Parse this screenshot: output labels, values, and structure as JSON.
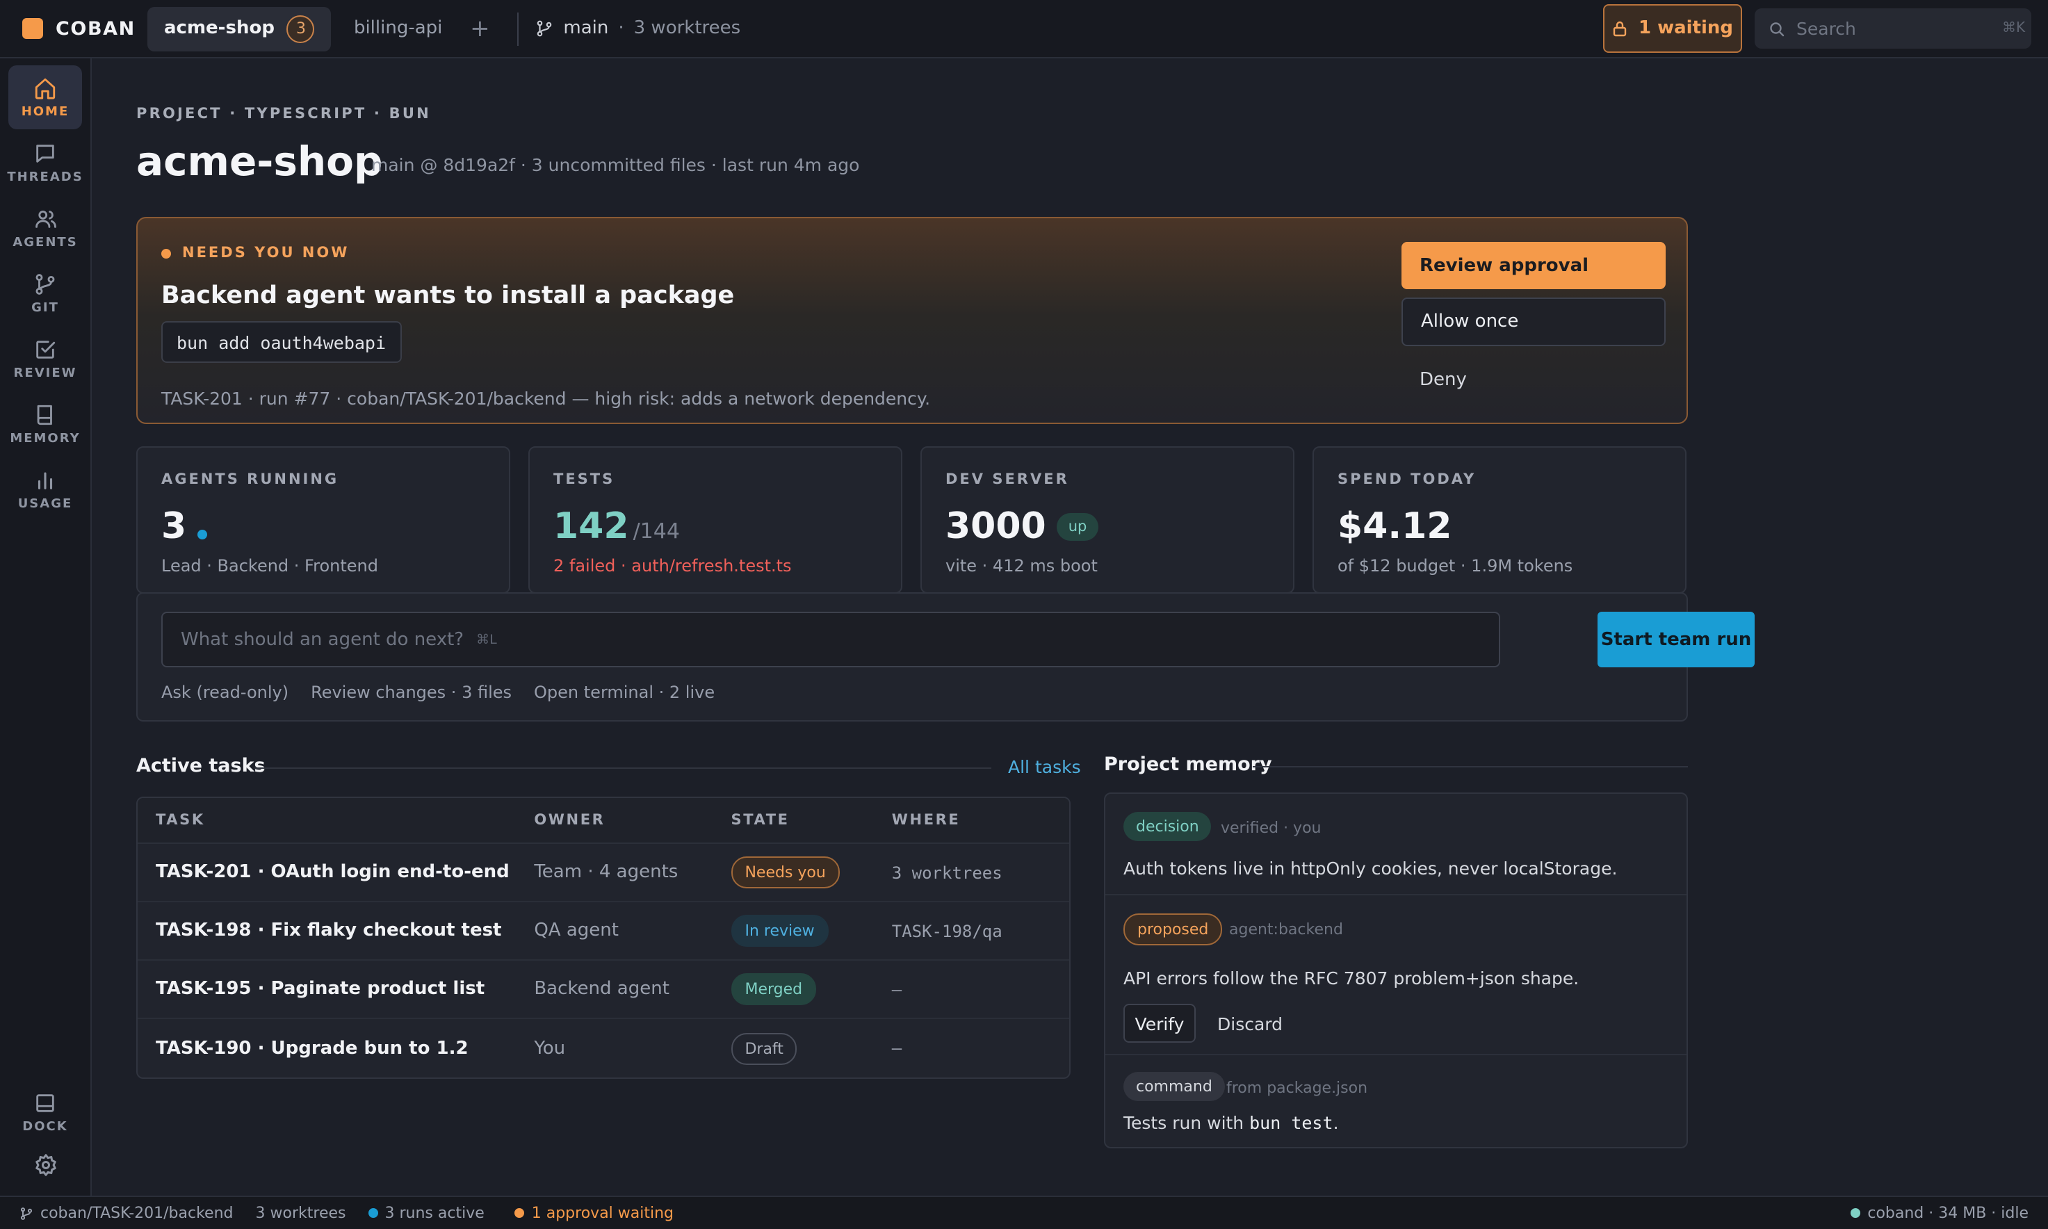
{
  "app": {
    "name": "COBAN",
    "brand_color": "#f59a4a"
  },
  "topbar": {
    "tabs": [
      {
        "label": "acme-shop",
        "count": "3",
        "active": true
      },
      {
        "label": "billing-api",
        "active": false
      }
    ],
    "add_tab_label": "+",
    "branch": "main",
    "worktrees": "3 worktrees",
    "waiting_label": "1 waiting",
    "search_placeholder": "Search",
    "search_shortcut": "⌘K"
  },
  "sidebar": {
    "items": [
      {
        "label": "HOME",
        "icon": "home-icon",
        "active": true
      },
      {
        "label": "THREADS",
        "icon": "chat-bubble-icon"
      },
      {
        "label": "AGENTS",
        "icon": "users-icon"
      },
      {
        "label": "GIT",
        "icon": "git-branch-icon"
      },
      {
        "label": "REVIEW",
        "icon": "check-square-icon"
      },
      {
        "label": "MEMORY",
        "icon": "book-icon"
      },
      {
        "label": "USAGE",
        "icon": "bar-chart-icon"
      }
    ],
    "dock_label": "DOCK",
    "settings_icon": "gear-icon"
  },
  "header": {
    "eyebrow": "PROJECT · TYPESCRIPT · BUN",
    "title": "acme-shop",
    "subtitle": "main @ 8d19a2f · 3 uncommitted files · last run 4m ago"
  },
  "alert": {
    "eyebrow": "NEEDS YOU NOW",
    "title": "Backend agent wants to install a package",
    "command": "bun add oauth4webapi",
    "meta": "TASK-201 · run #77 · coban/TASK-201/backend — high risk: adds a network dependency.",
    "primary_label": "Review approval",
    "allow_label": "Allow once",
    "deny_label": "Deny",
    "accent_color": "#f59a4a"
  },
  "stats": [
    {
      "key": "AGENTS RUNNING",
      "value": "3",
      "sub": "Lead · Backend · Frontend"
    },
    {
      "key": "TESTS",
      "value": "142",
      "suffix": "/144",
      "sub": "2 failed · auth/refresh.test.ts"
    },
    {
      "key": "DEV SERVER",
      "value": "3000",
      "badge": "up",
      "sub": "vite · 412 ms boot"
    },
    {
      "key": "SPEND TODAY",
      "value": "$4.12",
      "sub": "of $12 budget · 1.9M tokens"
    }
  ],
  "composer": {
    "placeholder": "What should an agent do next?",
    "shortcut": "⌘L",
    "run_label": "Start team run",
    "chips": [
      "Ask (read-only)",
      "Review changes · 3 files",
      "Open terminal · 2 live"
    ]
  },
  "tasks": {
    "title": "Active tasks",
    "all_label": "All tasks",
    "columns": [
      "TASK",
      "OWNER",
      "STATE",
      "WHERE"
    ],
    "rows": [
      {
        "task": "TASK-201 · OAuth login end-to-end",
        "owner": "Team · 4 agents",
        "state": "Needs you",
        "where": "3 worktrees"
      },
      {
        "task": "TASK-198 · Fix flaky checkout test",
        "owner": "QA agent",
        "state": "In review",
        "where": "TASK-198/qa"
      },
      {
        "task": "TASK-195 · Paginate product list",
        "owner": "Backend agent",
        "state": "Merged",
        "where": "—"
      },
      {
        "task": "TASK-190 · Upgrade bun to 1.2",
        "owner": "You",
        "state": "Draft",
        "where": "—"
      }
    ]
  },
  "memory": {
    "title": "Project memory",
    "items": [
      {
        "tag": "decision",
        "meta": "verified · you",
        "text": "Auth tokens live in httpOnly cookies, never localStorage."
      },
      {
        "tag": "proposed",
        "meta": "agent:backend",
        "text": "API errors follow the RFC 7807 problem+json shape.",
        "verify_label": "Verify",
        "discard_label": "Discard"
      },
      {
        "tag": "command",
        "meta": "from package.json",
        "text_prefix": "Tests run with ",
        "text_code": "bun test",
        "text_suffix": "."
      }
    ]
  },
  "statusbar": {
    "branch": "coban/TASK-201/backend",
    "worktrees": "3 worktrees",
    "runs": "3 runs active",
    "approvals": "1 approval waiting",
    "daemon": "coband · 34 MB · idle"
  },
  "colors": {
    "background": "#1c1f28",
    "sidebar": "#171920",
    "success": "#7fd0c4",
    "danger": "#f0605a",
    "info": "#1a9dd4",
    "warning": "#f59a4a"
  }
}
